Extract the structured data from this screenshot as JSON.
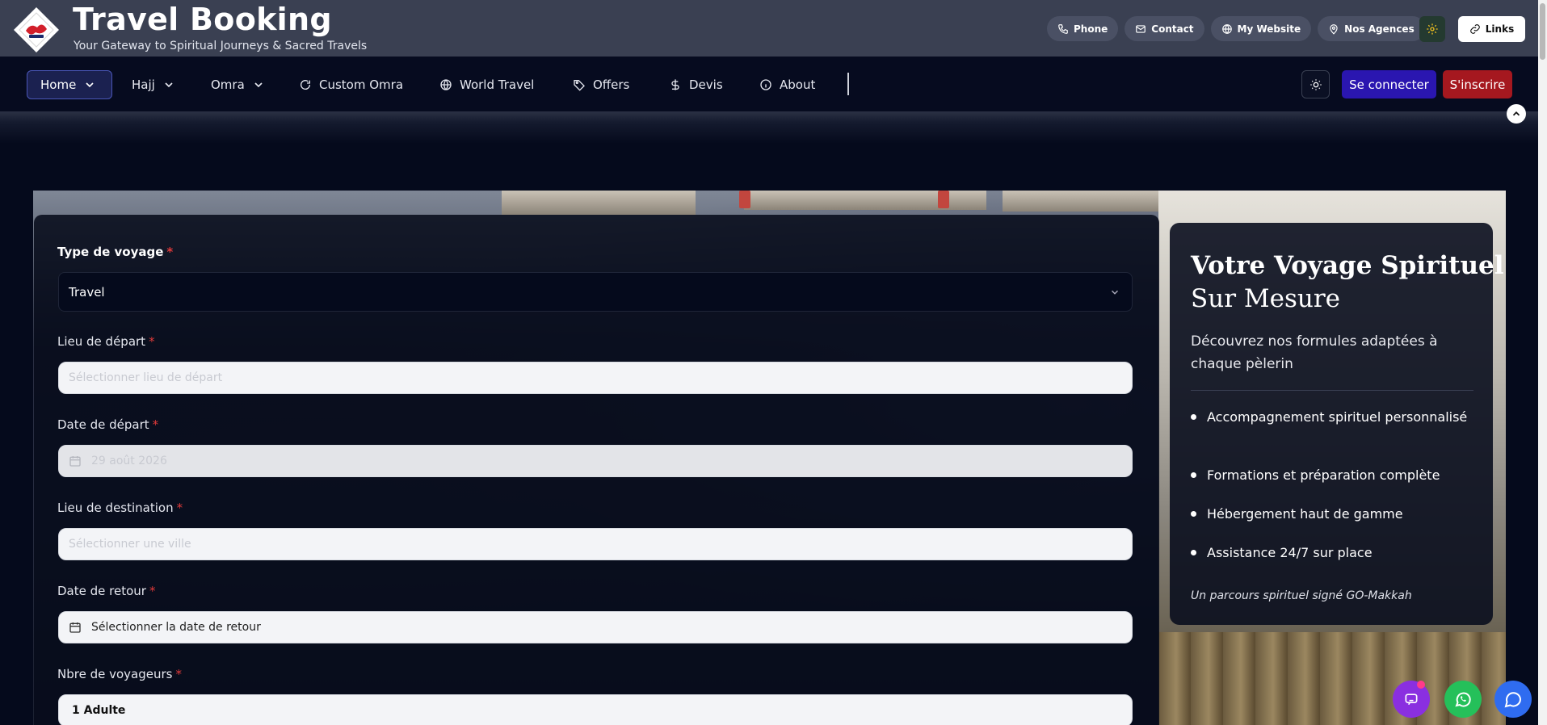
{
  "header": {
    "brand_title": "Travel Booking",
    "brand_subtitle": "Your Gateway to Spiritual Journeys & Sacred Travels",
    "top_links": [
      {
        "label": "Phone",
        "icon": "phone-icon"
      },
      {
        "label": "Contact",
        "icon": "mail-icon"
      },
      {
        "label": "My Website",
        "icon": "globe-icon"
      },
      {
        "label": "Nos Agences",
        "icon": "map-pin-icon"
      }
    ],
    "settings_icon": "gear-icon",
    "links_label": "Links"
  },
  "nav": {
    "items": [
      {
        "label": "Home",
        "icon": "chevron-down-icon",
        "active": true
      },
      {
        "label": "Hajj",
        "icon": "chevron-down-icon"
      },
      {
        "label": "Omra",
        "icon": "chevron-down-icon"
      },
      {
        "label": "Custom Omra",
        "icon": "refresh-icon"
      },
      {
        "label": "World Travel",
        "icon": "globe-icon"
      },
      {
        "label": "Offers",
        "icon": "tag-icon"
      },
      {
        "label": "Devis",
        "icon": "dollar-icon"
      },
      {
        "label": "About",
        "icon": "info-icon"
      }
    ],
    "login_label": "Se connecter",
    "signup_label": "S'inscrire"
  },
  "form": {
    "trip_type": {
      "label": "Type de voyage",
      "required": "*",
      "value": "Travel"
    },
    "departure_place": {
      "label": "Lieu de départ",
      "required": "*",
      "placeholder": "Sélectionner lieu de départ"
    },
    "departure_date": {
      "label": "Date de départ",
      "required": "*",
      "value": "29 août 2026"
    },
    "destination": {
      "label": "Lieu de destination",
      "required": "*",
      "placeholder": "Sélectionner une ville"
    },
    "return_date": {
      "label": "Date de retour",
      "required": "*",
      "placeholder": "Sélectionner la date de retour"
    },
    "travelers": {
      "label": "Nbre de voyageurs",
      "required": "*",
      "value": "1 Adulte"
    }
  },
  "info_card": {
    "title_line1": "Votre Voyage Spirituel",
    "title_line2": "Sur Mesure",
    "description": "Découvrez nos formules adaptées à chaque pèlerin",
    "features": [
      "Accompagnement spirituel personnalisé",
      "Formations et préparation complète",
      "Hébergement haut de gamme",
      "Assistance 24/7 sur place"
    ],
    "signature": "Un parcours spirituel signé GO-Makkah"
  },
  "colors": {
    "topbar": "#3a4052",
    "navbar": "#060b1f",
    "login_button": "#2a16b0",
    "signup_button": "#a5181f",
    "required": "#e03a3a"
  }
}
